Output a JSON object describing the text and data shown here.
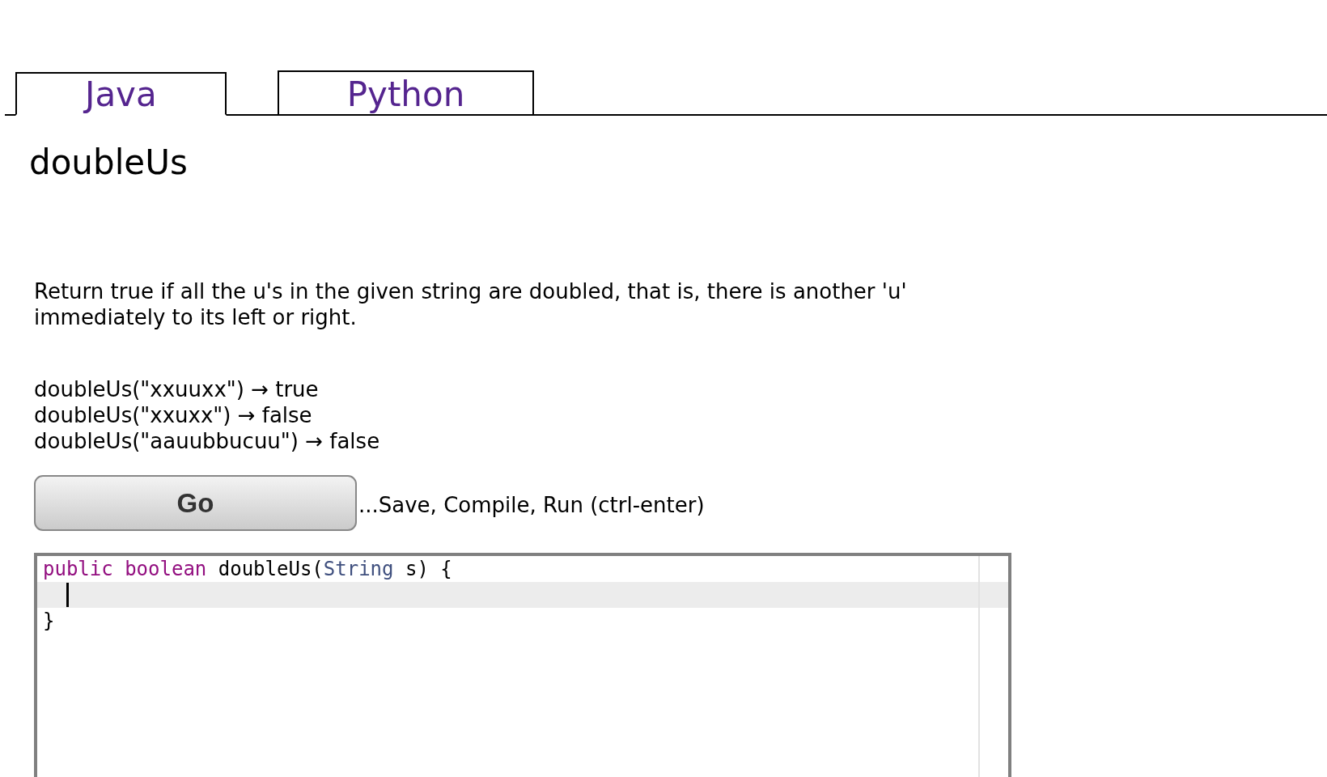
{
  "tabs": [
    {
      "label": "Java",
      "selected": true
    },
    {
      "label": "Python",
      "selected": false
    }
  ],
  "problem": {
    "title": "doubleUs",
    "description": "Return true if all the u's in the given string are doubled, that is, there is another 'u' immediately to its left or right.",
    "examples": [
      "doubleUs(\"xxuuxx\") → true",
      "doubleUs(\"xxuxx\") → false",
      "doubleUs(\"aauubbucuu\") → false"
    ]
  },
  "go_button": {
    "label": "Go"
  },
  "go_hint": "...Save, Compile, Run (ctrl-enter)",
  "editor": {
    "lines": [
      {
        "active": false,
        "cursor": false,
        "tokens": [
          {
            "kind": "keyword",
            "text": "public"
          },
          {
            "kind": "keyword",
            "text": " boolean"
          },
          {
            "kind": "plain",
            "text": " doubleUs("
          },
          {
            "kind": "type",
            "text": "String"
          },
          {
            "kind": "plain",
            "text": " s) {"
          }
        ]
      },
      {
        "active": true,
        "cursor": true
      },
      {
        "active": false,
        "cursor": false,
        "tokens": [
          {
            "kind": "plain",
            "text": "}"
          }
        ]
      }
    ]
  }
}
